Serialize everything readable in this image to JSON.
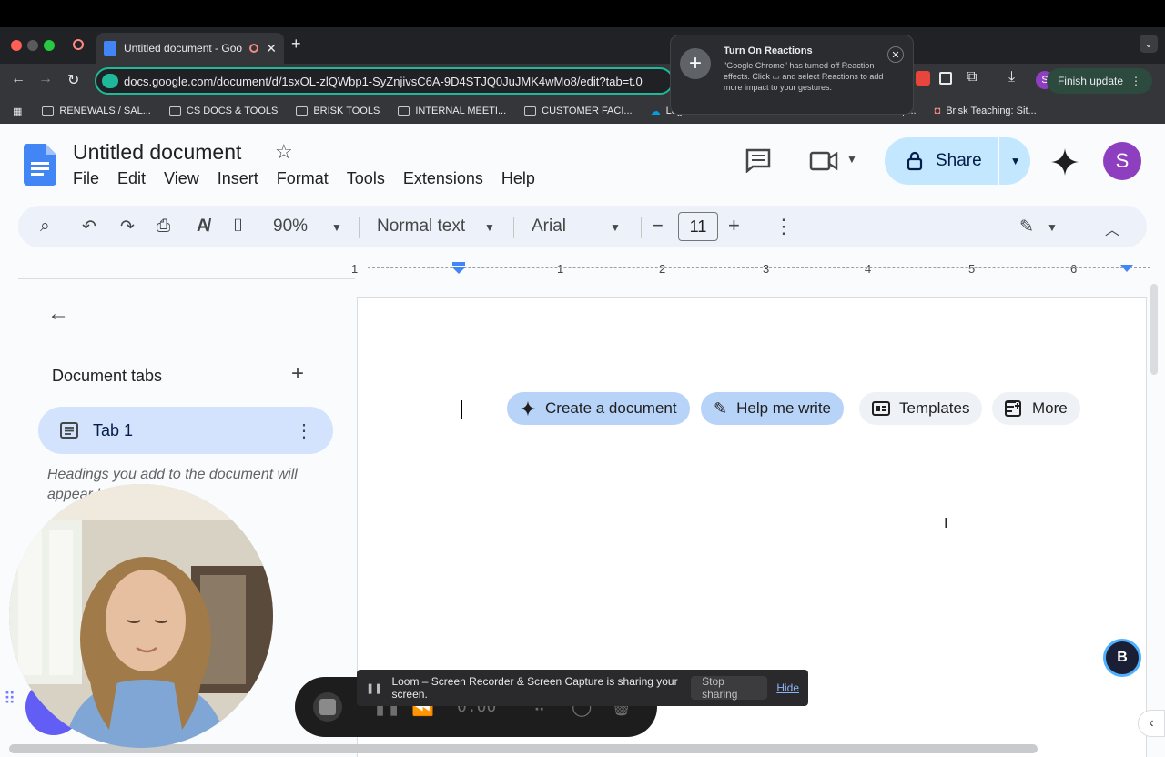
{
  "browser": {
    "tab_title": "Untitled document - Goog",
    "url": "docs.google.com/document/d/1sxOL-zlQWbp1-SyZnjivsC6A-9D4STJQ0JuJMK4wMo8/edit?tab=t.0",
    "finish_update": "Finish update",
    "profile_initial": "S",
    "bookmarks": [
      "RENEWALS / SAL...",
      "CS DOCS & TOOLS",
      "BRISK TOOLS",
      "INTERNAL MEETI...",
      "CUSTOMER FACI...",
      "Logi",
      "inancial Op...",
      "Brisk Teaching: Sit..."
    ]
  },
  "notification": {
    "title": "Turn On Reactions",
    "body": "\"Google Chrome\" has turned off Reaction effects. Click ▭ and select Reactions to add more impact to your gestures."
  },
  "docs": {
    "title": "Untitled document",
    "menu": [
      "File",
      "Edit",
      "View",
      "Insert",
      "Format",
      "Tools",
      "Extensions",
      "Help"
    ],
    "share_label": "Share",
    "avatar_initial": "S",
    "zoom": "90%",
    "style": "Normal text",
    "font": "Arial",
    "font_size": "11",
    "ruler_numbers": [
      "1",
      "1",
      "2",
      "3",
      "4",
      "5",
      "6"
    ],
    "sidebar": {
      "title": "Document tabs",
      "tab_label": "Tab 1",
      "hint": "Headings you add to the document will appear here."
    },
    "chips": [
      "Create a document",
      "Help me write",
      "Templates",
      "More"
    ]
  },
  "loom": {
    "timer": "0:00",
    "banner": "Loom – Screen Recorder & Screen Capture is sharing your screen.",
    "stop": "Stop sharing",
    "hide": "Hide"
  },
  "colors": {
    "share_bg": "#c2e7ff",
    "tab_active_bg": "#d3e3fd",
    "chip_blue": "#b7d3f7",
    "avatar": "#8e3fbf",
    "omnibox_border": "#1fb89a"
  }
}
